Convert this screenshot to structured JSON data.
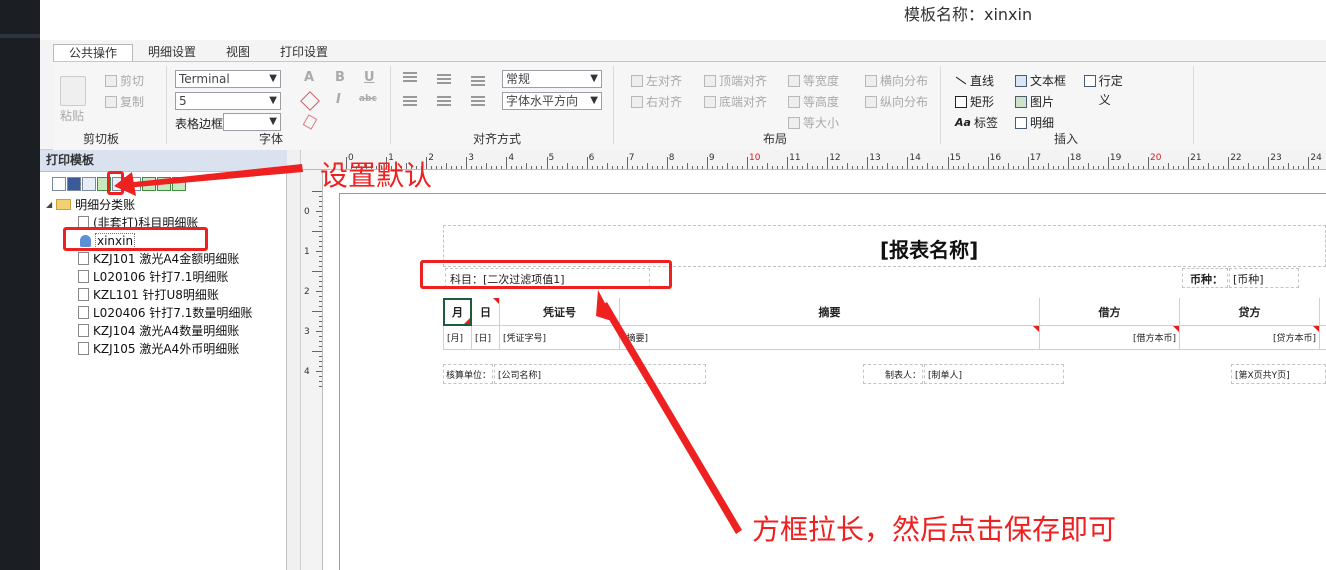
{
  "window": {
    "template_name": "模板名称：xinxin"
  },
  "ribbon": {
    "tabs": [
      "公共操作",
      "明细设置",
      "视图",
      "打印设置"
    ],
    "clipboard": {
      "paste": "粘贴",
      "cut": "剪切",
      "copy": "复制",
      "label": "剪切板"
    },
    "font": {
      "family": "Terminal",
      "size": "5",
      "border_label": "表格边框",
      "label": "字体",
      "bold": "B",
      "italic": "I",
      "underline": "U",
      "strike": "abc",
      "color_a": "A"
    },
    "align": {
      "mode": "常规",
      "text_align": "字体水平方向",
      "label": "对齐方式"
    },
    "layout": {
      "left_align": "左对齐",
      "right_align": "右对齐",
      "top_align": "顶端对齐",
      "bottom_align": "底端对齐",
      "equal_width": "等宽度",
      "equal_height": "等高度",
      "equal_size": "等大小",
      "h_dist": "横向分布",
      "v_dist": "纵向分布",
      "label": "布局"
    },
    "insert": {
      "line": "直线",
      "rect": "矩形",
      "label_tool": "标签",
      "textbox": "文本框",
      "image": "图片",
      "detail": "明细",
      "row_def": "行定义",
      "label": "插入"
    }
  },
  "left_panel": {
    "title": "打印模板",
    "tree": {
      "root": "明细分类账",
      "items": [
        "(非套打)科目明细账",
        "xinxin",
        "KZJ101 激光A4金额明细账",
        "L020106 针打7.1明细账",
        "KZL101 针打U8明细账",
        "L020406 针打7.1数量明细账",
        "KZJ104 激光A4数量明细账",
        "KZJ105 激光A4外币明细账"
      ]
    }
  },
  "ruler": {
    "h_ticks": [
      "0",
      "1",
      "2",
      "3",
      "4",
      "5",
      "6",
      "7",
      "8",
      "9",
      "10",
      "11",
      "12",
      "13",
      "14",
      "15",
      "16",
      "17",
      "18",
      "19",
      "20",
      "21",
      "22",
      "23",
      "24"
    ],
    "v_ticks": [
      "0",
      "1",
      "2",
      "3",
      "4"
    ]
  },
  "report": {
    "title": "[报表名称]",
    "subject": "科目：[二次过滤项值1]",
    "currency_label": "币种：",
    "currency_value": "[币种]",
    "headers": [
      "月",
      "日",
      "凭证号",
      "摘要",
      "借方",
      "贷方"
    ],
    "row": [
      "[月]",
      "[日]",
      "[凭证字号]",
      "[摘要]",
      "[借方本币]",
      "[贷方本币]"
    ],
    "footer": {
      "unit_label": "核算单位：",
      "unit_value": "[公司名称]",
      "maker_label": "制表人：",
      "maker_value": "[制单人]",
      "page": "[第X页共Y页]"
    }
  },
  "annotations": {
    "set_default": "设置默认",
    "instruction": "方框拉长，然后点击保存即可"
  },
  "colors": {
    "annotation_red": "#ee2020",
    "panel_header": "#d9e2ee",
    "dark_sidebar": "#1b1f24"
  }
}
